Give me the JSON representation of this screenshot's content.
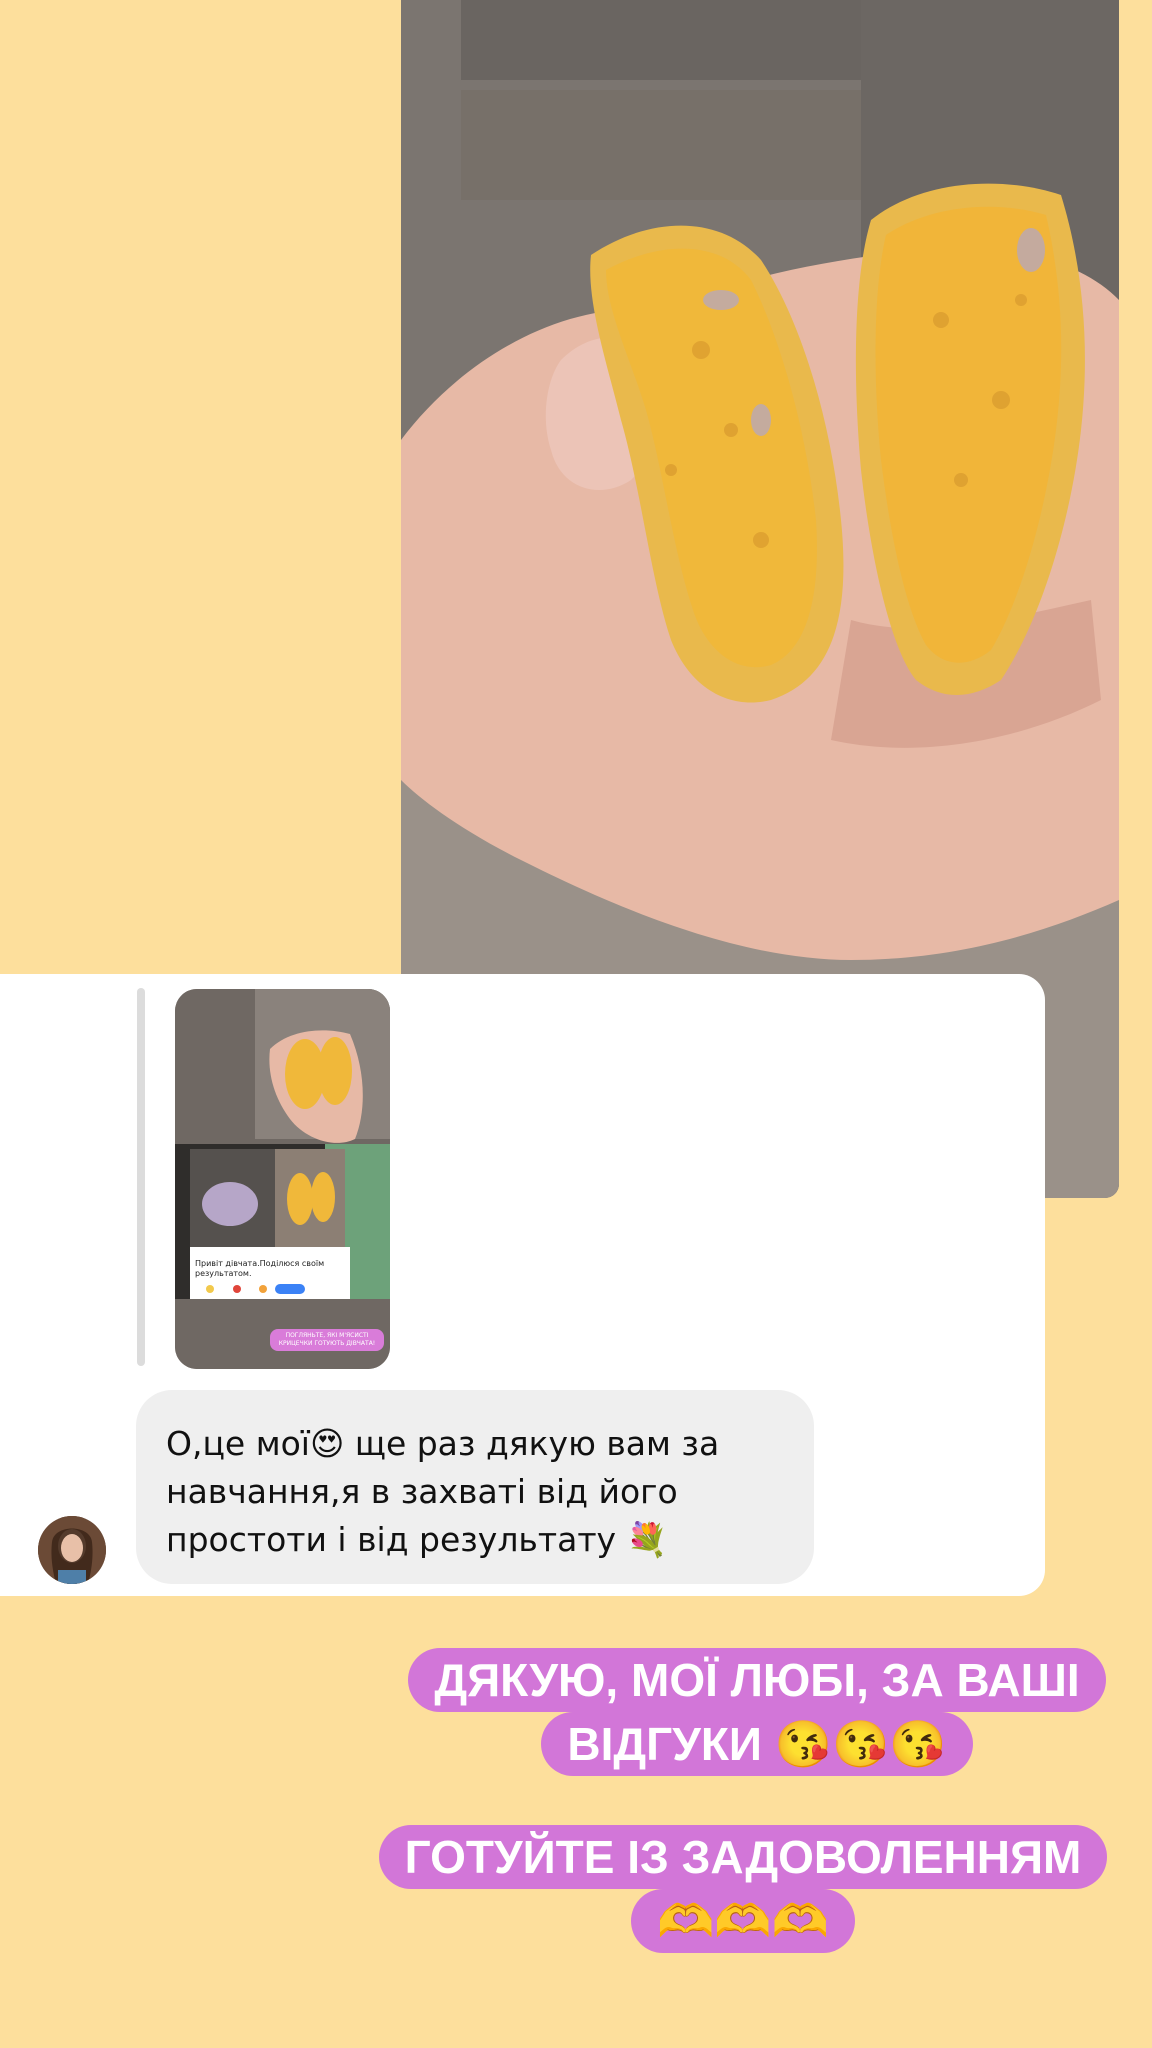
{
  "dm": {
    "story_text": "Привіт дівчата.Поділюся своїм результатом.",
    "story_sticker": "ПОГЛЯНЬТЕ, ЯКІ М'ЯСИСТІ КРИЦЕЧКИ ГОТУЮТЬ ДІВЧАТА!",
    "message": "О,це мої😍  ще раз дякую вам за\nнавчання,я в захваті від його\nпростоти і від результату 💐"
  },
  "captions": {
    "line1": "ДЯКУЮ, МОЇ ЛЮБІ, ЗА ВАШІ",
    "line2": "ВІДГУКИ 😘😘😘",
    "line3": "ГОТУЙТЕ ІЗ ЗАДОВОЛЕННЯМ",
    "line4": "🫶🫶🫶"
  },
  "colors": {
    "background": "#FDDF9C",
    "sticker": "#D276D8",
    "bubble": "#EFEFEF"
  }
}
